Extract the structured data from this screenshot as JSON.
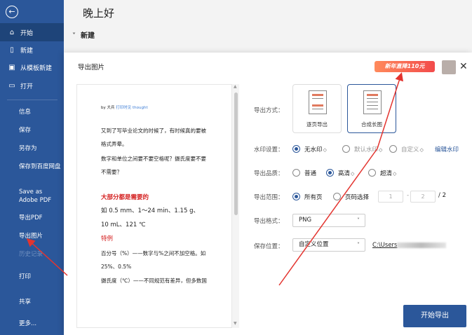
{
  "sidebar": {
    "back_icon": "arrow-left-icon",
    "items": [
      {
        "label": "开始",
        "icon": "home-icon"
      },
      {
        "label": "新建",
        "icon": "new-doc-icon"
      },
      {
        "label": "从模板新建",
        "icon": "template-icon"
      },
      {
        "label": "打开",
        "icon": "folder-open-icon"
      }
    ],
    "plain_items": [
      "信息",
      "保存",
      "另存为",
      "保存到百度网盘",
      "Save as Adobe PDF",
      "导出PDF",
      "导出图片",
      "历史记录",
      "打印",
      "共享",
      "更多..."
    ]
  },
  "main": {
    "greeting": "晚上好",
    "section_new": "新建",
    "chevron": "˅"
  },
  "dialog": {
    "title": "导出图片",
    "promo": "新年直降110元",
    "close": "✕",
    "preview": {
      "author_prefix": "by 大兵",
      "author_link": "打印时见 thought",
      "lines": [
        "又到了写毕业论文的时候了，有时候真的要被",
        "格式弄晕。",
        "数字和单位之间要不要空格呢？摄氏度要不要",
        "不需要？",
        "大部分都是需要的",
        "如 0.5 mm、1～24 min、1.15 g、",
        "10 mL、121 ℃",
        "特例",
        "百分号（%）——数字与%之间不加空格。如",
        "25%、0.5%",
        "摄氏度（℃）——不同规范有差异，但多数国"
      ]
    },
    "labels": {
      "export_mode": "导出方式：",
      "watermark": "水印设置：",
      "quality": "导出品质：",
      "range": "导出范围：",
      "format": "导出格式：",
      "save_location": "保存位置："
    },
    "export_modes": [
      {
        "label": "逐页导出",
        "selected": false
      },
      {
        "label": "合成长图",
        "selected": true
      }
    ],
    "watermark_options": [
      {
        "label": "无水印",
        "selected": true,
        "gem": "◇"
      },
      {
        "label": "默认水印",
        "selected": false,
        "gem": "◇"
      },
      {
        "label": "自定义",
        "selected": false,
        "gem": "◇"
      }
    ],
    "edit_watermark": "编辑水印",
    "quality_options": [
      {
        "label": "普通",
        "selected": false
      },
      {
        "label": "高清",
        "selected": true,
        "gem": "◇"
      },
      {
        "label": "超清",
        "selected": false,
        "gem": "◇"
      }
    ],
    "range_options": [
      {
        "label": "所有页",
        "selected": true
      },
      {
        "label": "页码选择",
        "selected": false
      }
    ],
    "range_from": "1",
    "range_dash": "-",
    "range_to": "2",
    "range_total": "/ 2",
    "format_value": "PNG",
    "location_value": "自定义位置",
    "path_prefix": "C:\\Users",
    "export_button": "开始导出"
  },
  "colors": {
    "sidebar": "#2b579a",
    "accent": "#2b579a",
    "arrow": "#e3342f"
  }
}
